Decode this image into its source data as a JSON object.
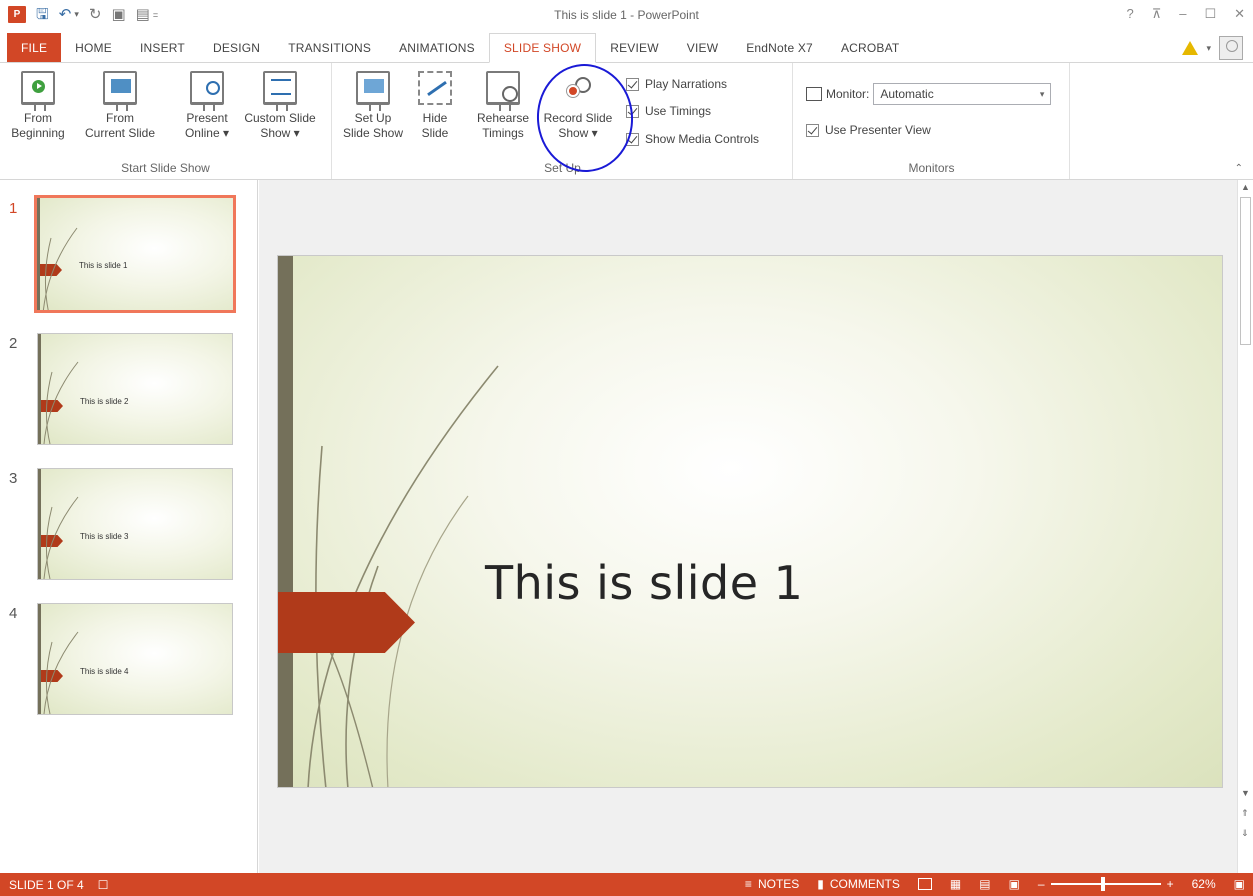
{
  "window": {
    "title": "This is slide 1 - PowerPoint",
    "app_logo": "P",
    "controls": [
      "?",
      "⊼",
      "–",
      "☐",
      "✕"
    ]
  },
  "qat": {
    "save_icon": "save-icon",
    "undo_icon": "undo-icon",
    "redo_icon": "redo-icon",
    "caret": "▾",
    "customize": "="
  },
  "tabs": [
    "FILE",
    "HOME",
    "INSERT",
    "DESIGN",
    "TRANSITIONS",
    "ANIMATIONS",
    "SLIDE SHOW",
    "REVIEW",
    "VIEW",
    "EndNote X7",
    "ACROBAT"
  ],
  "active_tab": "SLIDE SHOW",
  "ribbon": {
    "start": {
      "label": "Start Slide Show",
      "from_beginning": [
        "From",
        "Beginning"
      ],
      "from_current": [
        "From",
        "Current Slide"
      ],
      "present_online": [
        "Present",
        "Online ▾"
      ],
      "custom_show": [
        "Custom Slide",
        "Show ▾"
      ]
    },
    "setup": {
      "label": "Set Up",
      "set_up_show": [
        "Set Up",
        "Slide Show"
      ],
      "hide_slide": [
        "Hide",
        "Slide"
      ],
      "rehearse": [
        "Rehearse",
        "Timings"
      ],
      "record": [
        "Record Slide",
        "Show ▾"
      ],
      "checkboxes": [
        "Play Narrations",
        "Use Timings",
        "Show Media Controls"
      ]
    },
    "monitors": {
      "label": "Monitors",
      "monitor_label": "Monitor:",
      "monitor_value": "Automatic",
      "presenter_view": "Use Presenter View"
    }
  },
  "thumbnails": [
    {
      "num": "1",
      "title": "This is slide 1",
      "active": true
    },
    {
      "num": "2",
      "title": "This is slide 2",
      "active": false
    },
    {
      "num": "3",
      "title": "This is slide 3",
      "active": false
    },
    {
      "num": "4",
      "title": "This is slide 4",
      "active": false
    }
  ],
  "slide": {
    "title": "This is slide 1",
    "accent_bar": "#74705a",
    "arrow_color": "#b03a1a"
  },
  "status": {
    "slide_info": "SLIDE 1 OF 4",
    "notes": "NOTES",
    "comments": "COMMENTS",
    "zoom": "62%",
    "zoom_fraction": 0.62,
    "accent": "#d24726"
  }
}
